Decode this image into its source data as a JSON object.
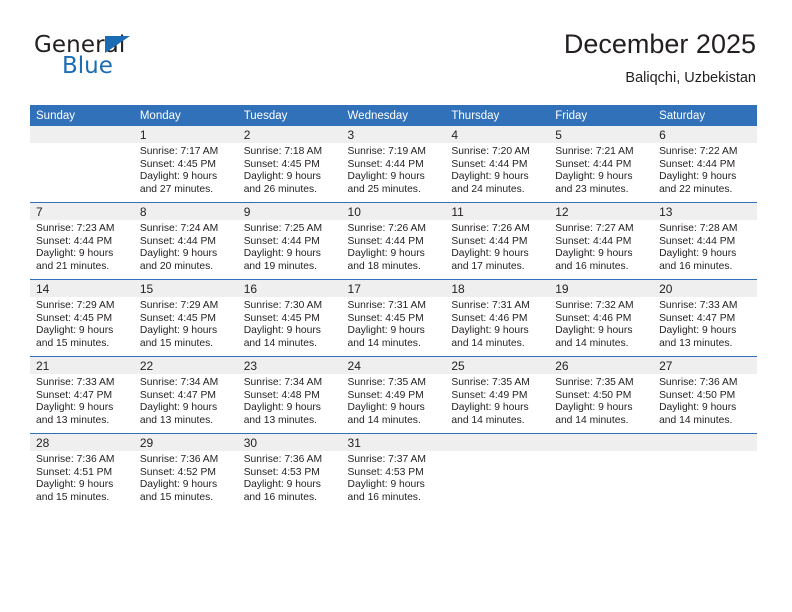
{
  "brand": {
    "name_top": "General",
    "name_bottom": "Blue",
    "accent_color": "#1c6cb5",
    "triangle_icon": "triangle-icon"
  },
  "header": {
    "title": "December 2025",
    "subtitle": "Baliqchi, Uzbekistan"
  },
  "colors": {
    "header_blue": "#3071b9",
    "daynum_band": "#efefef",
    "text": "#231f20",
    "cell_background": "#ffffff"
  },
  "calendar": {
    "weekday_headers": [
      "Sunday",
      "Monday",
      "Tuesday",
      "Wednesday",
      "Thursday",
      "Friday",
      "Saturday"
    ],
    "weeks": [
      [
        {
          "day": "",
          "empty": true,
          "sunrise": "",
          "sunset": "",
          "daylight_line1": "",
          "daylight_line2": ""
        },
        {
          "day": "1",
          "empty": false,
          "sunrise": "Sunrise: 7:17 AM",
          "sunset": "Sunset: 4:45 PM",
          "daylight_line1": "Daylight: 9 hours",
          "daylight_line2": "and 27 minutes."
        },
        {
          "day": "2",
          "empty": false,
          "sunrise": "Sunrise: 7:18 AM",
          "sunset": "Sunset: 4:45 PM",
          "daylight_line1": "Daylight: 9 hours",
          "daylight_line2": "and 26 minutes."
        },
        {
          "day": "3",
          "empty": false,
          "sunrise": "Sunrise: 7:19 AM",
          "sunset": "Sunset: 4:44 PM",
          "daylight_line1": "Daylight: 9 hours",
          "daylight_line2": "and 25 minutes."
        },
        {
          "day": "4",
          "empty": false,
          "sunrise": "Sunrise: 7:20 AM",
          "sunset": "Sunset: 4:44 PM",
          "daylight_line1": "Daylight: 9 hours",
          "daylight_line2": "and 24 minutes."
        },
        {
          "day": "5",
          "empty": false,
          "sunrise": "Sunrise: 7:21 AM",
          "sunset": "Sunset: 4:44 PM",
          "daylight_line1": "Daylight: 9 hours",
          "daylight_line2": "and 23 minutes."
        },
        {
          "day": "6",
          "empty": false,
          "sunrise": "Sunrise: 7:22 AM",
          "sunset": "Sunset: 4:44 PM",
          "daylight_line1": "Daylight: 9 hours",
          "daylight_line2": "and 22 minutes."
        }
      ],
      [
        {
          "day": "7",
          "empty": false,
          "sunrise": "Sunrise: 7:23 AM",
          "sunset": "Sunset: 4:44 PM",
          "daylight_line1": "Daylight: 9 hours",
          "daylight_line2": "and 21 minutes."
        },
        {
          "day": "8",
          "empty": false,
          "sunrise": "Sunrise: 7:24 AM",
          "sunset": "Sunset: 4:44 PM",
          "daylight_line1": "Daylight: 9 hours",
          "daylight_line2": "and 20 minutes."
        },
        {
          "day": "9",
          "empty": false,
          "sunrise": "Sunrise: 7:25 AM",
          "sunset": "Sunset: 4:44 PM",
          "daylight_line1": "Daylight: 9 hours",
          "daylight_line2": "and 19 minutes."
        },
        {
          "day": "10",
          "empty": false,
          "sunrise": "Sunrise: 7:26 AM",
          "sunset": "Sunset: 4:44 PM",
          "daylight_line1": "Daylight: 9 hours",
          "daylight_line2": "and 18 minutes."
        },
        {
          "day": "11",
          "empty": false,
          "sunrise": "Sunrise: 7:26 AM",
          "sunset": "Sunset: 4:44 PM",
          "daylight_line1": "Daylight: 9 hours",
          "daylight_line2": "and 17 minutes."
        },
        {
          "day": "12",
          "empty": false,
          "sunrise": "Sunrise: 7:27 AM",
          "sunset": "Sunset: 4:44 PM",
          "daylight_line1": "Daylight: 9 hours",
          "daylight_line2": "and 16 minutes."
        },
        {
          "day": "13",
          "empty": false,
          "sunrise": "Sunrise: 7:28 AM",
          "sunset": "Sunset: 4:44 PM",
          "daylight_line1": "Daylight: 9 hours",
          "daylight_line2": "and 16 minutes."
        }
      ],
      [
        {
          "day": "14",
          "empty": false,
          "sunrise": "Sunrise: 7:29 AM",
          "sunset": "Sunset: 4:45 PM",
          "daylight_line1": "Daylight: 9 hours",
          "daylight_line2": "and 15 minutes."
        },
        {
          "day": "15",
          "empty": false,
          "sunrise": "Sunrise: 7:29 AM",
          "sunset": "Sunset: 4:45 PM",
          "daylight_line1": "Daylight: 9 hours",
          "daylight_line2": "and 15 minutes."
        },
        {
          "day": "16",
          "empty": false,
          "sunrise": "Sunrise: 7:30 AM",
          "sunset": "Sunset: 4:45 PM",
          "daylight_line1": "Daylight: 9 hours",
          "daylight_line2": "and 14 minutes."
        },
        {
          "day": "17",
          "empty": false,
          "sunrise": "Sunrise: 7:31 AM",
          "sunset": "Sunset: 4:45 PM",
          "daylight_line1": "Daylight: 9 hours",
          "daylight_line2": "and 14 minutes."
        },
        {
          "day": "18",
          "empty": false,
          "sunrise": "Sunrise: 7:31 AM",
          "sunset": "Sunset: 4:46 PM",
          "daylight_line1": "Daylight: 9 hours",
          "daylight_line2": "and 14 minutes."
        },
        {
          "day": "19",
          "empty": false,
          "sunrise": "Sunrise: 7:32 AM",
          "sunset": "Sunset: 4:46 PM",
          "daylight_line1": "Daylight: 9 hours",
          "daylight_line2": "and 14 minutes."
        },
        {
          "day": "20",
          "empty": false,
          "sunrise": "Sunrise: 7:33 AM",
          "sunset": "Sunset: 4:47 PM",
          "daylight_line1": "Daylight: 9 hours",
          "daylight_line2": "and 13 minutes."
        }
      ],
      [
        {
          "day": "21",
          "empty": false,
          "sunrise": "Sunrise: 7:33 AM",
          "sunset": "Sunset: 4:47 PM",
          "daylight_line1": "Daylight: 9 hours",
          "daylight_line2": "and 13 minutes."
        },
        {
          "day": "22",
          "empty": false,
          "sunrise": "Sunrise: 7:34 AM",
          "sunset": "Sunset: 4:47 PM",
          "daylight_line1": "Daylight: 9 hours",
          "daylight_line2": "and 13 minutes."
        },
        {
          "day": "23",
          "empty": false,
          "sunrise": "Sunrise: 7:34 AM",
          "sunset": "Sunset: 4:48 PM",
          "daylight_line1": "Daylight: 9 hours",
          "daylight_line2": "and 13 minutes."
        },
        {
          "day": "24",
          "empty": false,
          "sunrise": "Sunrise: 7:35 AM",
          "sunset": "Sunset: 4:49 PM",
          "daylight_line1": "Daylight: 9 hours",
          "daylight_line2": "and 14 minutes."
        },
        {
          "day": "25",
          "empty": false,
          "sunrise": "Sunrise: 7:35 AM",
          "sunset": "Sunset: 4:49 PM",
          "daylight_line1": "Daylight: 9 hours",
          "daylight_line2": "and 14 minutes."
        },
        {
          "day": "26",
          "empty": false,
          "sunrise": "Sunrise: 7:35 AM",
          "sunset": "Sunset: 4:50 PM",
          "daylight_line1": "Daylight: 9 hours",
          "daylight_line2": "and 14 minutes."
        },
        {
          "day": "27",
          "empty": false,
          "sunrise": "Sunrise: 7:36 AM",
          "sunset": "Sunset: 4:50 PM",
          "daylight_line1": "Daylight: 9 hours",
          "daylight_line2": "and 14 minutes."
        }
      ],
      [
        {
          "day": "28",
          "empty": false,
          "sunrise": "Sunrise: 7:36 AM",
          "sunset": "Sunset: 4:51 PM",
          "daylight_line1": "Daylight: 9 hours",
          "daylight_line2": "and 15 minutes."
        },
        {
          "day": "29",
          "empty": false,
          "sunrise": "Sunrise: 7:36 AM",
          "sunset": "Sunset: 4:52 PM",
          "daylight_line1": "Daylight: 9 hours",
          "daylight_line2": "and 15 minutes."
        },
        {
          "day": "30",
          "empty": false,
          "sunrise": "Sunrise: 7:36 AM",
          "sunset": "Sunset: 4:53 PM",
          "daylight_line1": "Daylight: 9 hours",
          "daylight_line2": "and 16 minutes."
        },
        {
          "day": "31",
          "empty": false,
          "sunrise": "Sunrise: 7:37 AM",
          "sunset": "Sunset: 4:53 PM",
          "daylight_line1": "Daylight: 9 hours",
          "daylight_line2": "and 16 minutes."
        },
        {
          "day": "",
          "empty": true,
          "sunrise": "",
          "sunset": "",
          "daylight_line1": "",
          "daylight_line2": ""
        },
        {
          "day": "",
          "empty": true,
          "sunrise": "",
          "sunset": "",
          "daylight_line1": "",
          "daylight_line2": ""
        },
        {
          "day": "",
          "empty": true,
          "sunrise": "",
          "sunset": "",
          "daylight_line1": "",
          "daylight_line2": ""
        }
      ]
    ]
  }
}
